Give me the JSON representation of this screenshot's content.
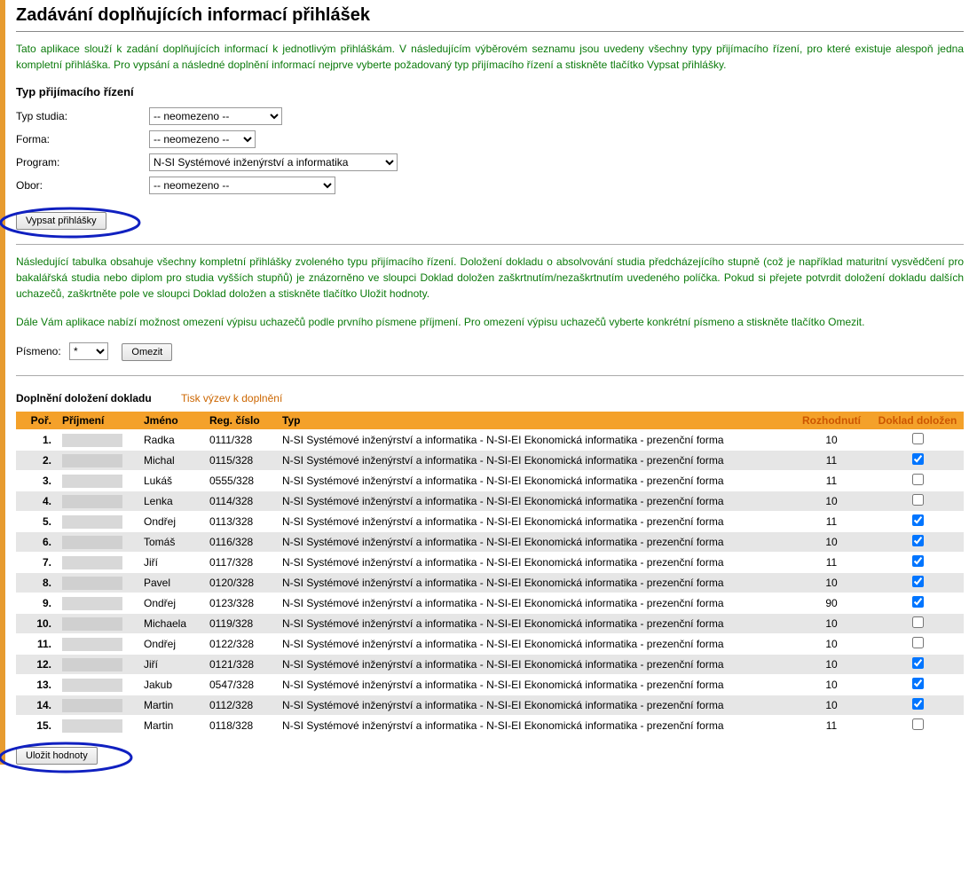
{
  "header": {
    "title": "Zadávání doplňujících informací přihlášek"
  },
  "intro": "Tato aplikace slouží k zadání doplňujících informací k jednotlivým přihláškám. V následujícím výběrovém seznamu jsou uvedeny všechny typy přijímacího řízení, pro které existuje alespoň jedna kompletní přihláška. Pro vypsání a následné doplnění informací nejprve vyberte požadovaný typ přijímacího řízení a stiskněte tlačítko Vypsat přihlášky.",
  "form": {
    "section_title": "Typ přijímacího řízení",
    "labels": {
      "typ_studia": "Typ studia:",
      "forma": "Forma:",
      "program": "Program:",
      "obor": "Obor:"
    },
    "values": {
      "typ_studia": "-- neomezeno --",
      "forma": "-- neomezeno --",
      "program": "N-SI Systémové inženýrství a informatika",
      "obor": "-- neomezeno --"
    },
    "submit_label": "Vypsat přihlášky"
  },
  "table_intro": "Následující tabulka obsahuje všechny kompletní přihlášky zvoleného typu přijímacího řízení. Doložení dokladu o absolvování studia předcházejícího stupně (což je například maturitní vysvědčení pro bakalářská studia nebo diplom pro studia vyšších stupňů) je znázorněno ve sloupci Doklad doložen zaškrtnutím/nezaškrtnutím uvedeného políčka. Pokud si přejete potvrdit doložení dokladu dalších uchazečů, zaškrtněte pole ve sloupci Doklad doložen a stiskněte tlačítko Uložit hodnoty.",
  "filter_intro": "Dále Vám aplikace nabízí možnost omezení výpisu uchazečů podle prvního písmene příjmení. Pro omezení výpisu uchazečů vyberte konkrétní písmeno a stiskněte tlačítko Omezit.",
  "filter": {
    "label": "Písmeno:",
    "value": "*",
    "button": "Omezit"
  },
  "tabs": {
    "active": "Doplnění doložení dokladu",
    "inactive": "Tisk výzev k doplnění"
  },
  "columns": {
    "por": "Poř.",
    "prijmeni": "Příjmení",
    "jmeno": "Jméno",
    "reg": "Reg. číslo",
    "typ": "Typ",
    "rozhodnuti": "Rozhodnutí",
    "doklad": "Doklad doložen"
  },
  "typ_text": "N-SI Systémové inženýrství a informatika - N-SI-EI Ekonomická informatika - prezenční forma",
  "rows": [
    {
      "por": "1.",
      "jmeno": "Radka",
      "reg": "0111/328",
      "rozh": "10",
      "doklad": false
    },
    {
      "por": "2.",
      "jmeno": "Michal",
      "reg": "0115/328",
      "rozh": "11",
      "doklad": true
    },
    {
      "por": "3.",
      "jmeno": "Lukáš",
      "reg": "0555/328",
      "rozh": "11",
      "doklad": false
    },
    {
      "por": "4.",
      "jmeno": "Lenka",
      "reg": "0114/328",
      "rozh": "10",
      "doklad": false
    },
    {
      "por": "5.",
      "jmeno": "Ondřej",
      "reg": "0113/328",
      "rozh": "11",
      "doklad": true
    },
    {
      "por": "6.",
      "jmeno": "Tomáš",
      "reg": "0116/328",
      "rozh": "10",
      "doklad": true
    },
    {
      "por": "7.",
      "jmeno": "Jiří",
      "reg": "0117/328",
      "rozh": "11",
      "doklad": true
    },
    {
      "por": "8.",
      "jmeno": "Pavel",
      "reg": "0120/328",
      "rozh": "10",
      "doklad": true
    },
    {
      "por": "9.",
      "jmeno": "Ondřej",
      "reg": "0123/328",
      "rozh": "90",
      "doklad": true
    },
    {
      "por": "10.",
      "jmeno": "Michaela",
      "reg": "0119/328",
      "rozh": "10",
      "doklad": false
    },
    {
      "por": "11.",
      "jmeno": "Ondřej",
      "reg": "0122/328",
      "rozh": "10",
      "doklad": false
    },
    {
      "por": "12.",
      "jmeno": "Jiří",
      "reg": "0121/328",
      "rozh": "10",
      "doklad": true
    },
    {
      "por": "13.",
      "jmeno": "Jakub",
      "reg": "0547/328",
      "rozh": "10",
      "doklad": true
    },
    {
      "por": "14.",
      "jmeno": "Martin",
      "reg": "0112/328",
      "rozh": "10",
      "doklad": true
    },
    {
      "por": "15.",
      "jmeno": "Martin",
      "reg": "0118/328",
      "rozh": "11",
      "doklad": false
    }
  ],
  "save_label": "Uložit hodnoty"
}
